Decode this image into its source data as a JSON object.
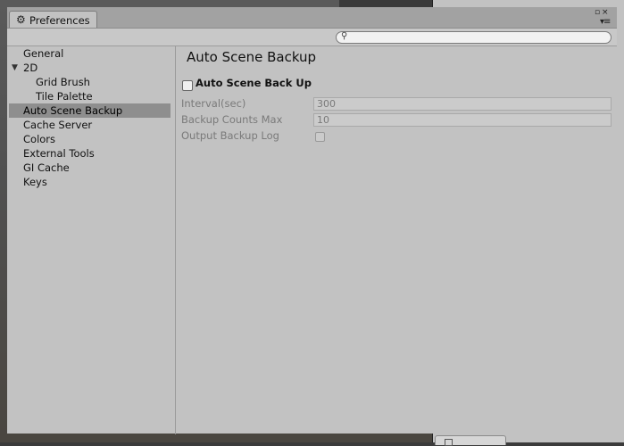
{
  "window": {
    "tab_title": "Preferences",
    "tab_icon": "gear-icon"
  },
  "search": {
    "placeholder": ""
  },
  "sidebar": {
    "items": [
      {
        "label": "General",
        "level": 0,
        "selected": false
      },
      {
        "label": "2D",
        "level": 0,
        "selected": false,
        "expanded": true
      },
      {
        "label": "Grid Brush",
        "level": 1,
        "selected": false
      },
      {
        "label": "Tile Palette",
        "level": 1,
        "selected": false
      },
      {
        "label": "Auto Scene Backup",
        "level": 0,
        "selected": true
      },
      {
        "label": "Cache Server",
        "level": 0,
        "selected": false
      },
      {
        "label": "Colors",
        "level": 0,
        "selected": false
      },
      {
        "label": "External Tools",
        "level": 0,
        "selected": false
      },
      {
        "label": "GI Cache",
        "level": 0,
        "selected": false
      },
      {
        "label": "Keys",
        "level": 0,
        "selected": false
      }
    ]
  },
  "panel": {
    "title": "Auto Scene Backup",
    "enable_label": "Auto Scene Back Up",
    "enable_checked": false,
    "fields": [
      {
        "label": "Interval(sec)",
        "value": "300"
      },
      {
        "label": "Backup Counts Max",
        "value": "10"
      }
    ],
    "log_label": "Output Backup Log",
    "log_checked": false
  }
}
